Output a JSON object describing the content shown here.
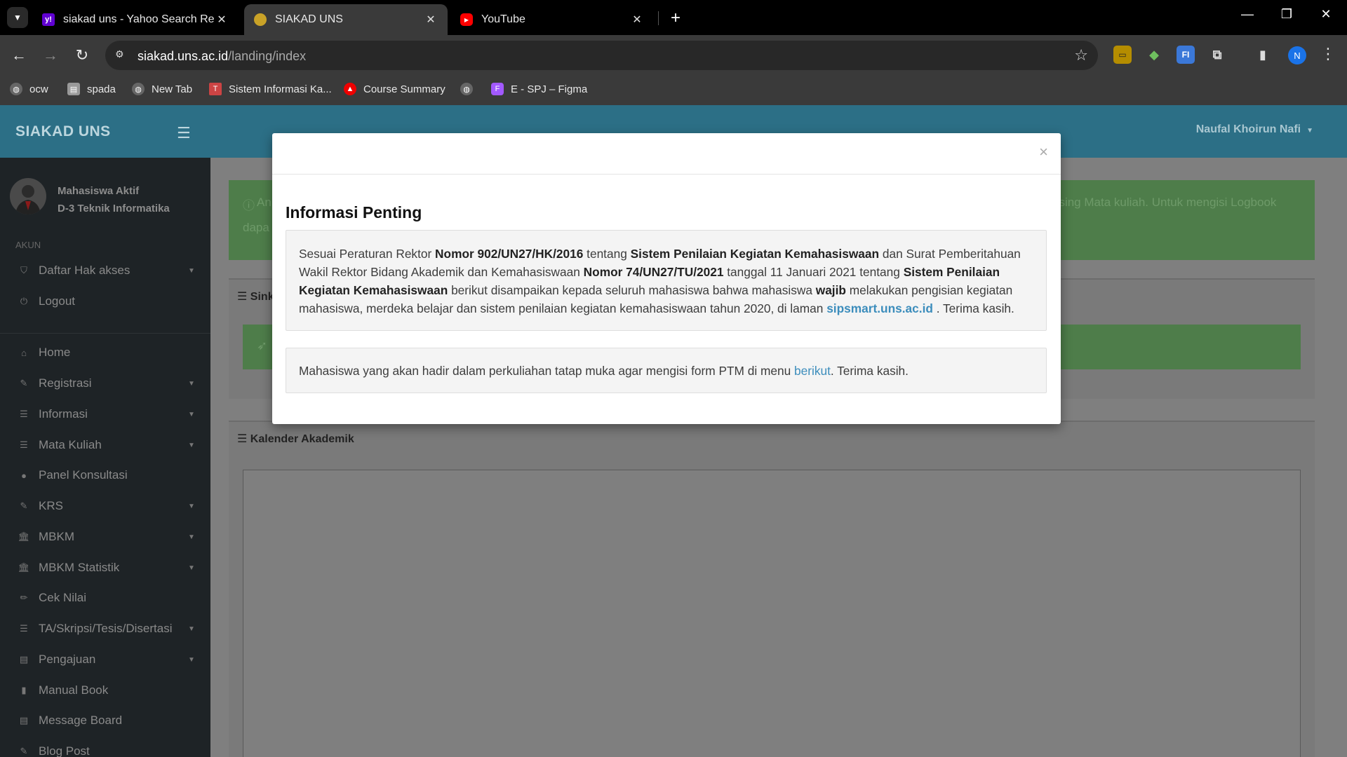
{
  "browser": {
    "tabs": [
      {
        "title": "siakad uns - Yahoo Search Resu",
        "icon": "yahoo-icon",
        "color": "#6001d2"
      },
      {
        "title": "SIAKAD UNS",
        "icon": "uns-logo-icon",
        "color": "#d4a017"
      },
      {
        "title": "YouTube",
        "icon": "youtube-icon",
        "color": "#ff0000"
      }
    ],
    "url_host": "siakad.uns.ac.id",
    "url_path": "/landing/index",
    "profile_initial": "N",
    "bookmarks": [
      {
        "label": "ocw",
        "icon": "globe-icon"
      },
      {
        "label": "spada",
        "icon": "spada-icon"
      },
      {
        "label": "New Tab",
        "icon": "globe-icon"
      },
      {
        "label": "Sistem Informasi Ka...",
        "icon": "bookmark-site-icon"
      },
      {
        "label": "Course Summary",
        "icon": "redhat-icon"
      },
      {
        "label": "",
        "icon": "globe-icon"
      },
      {
        "label": "E - SPJ – Figma",
        "icon": "figma-icon"
      }
    ]
  },
  "app": {
    "brand": "SIAKAD UNS",
    "user_name": "Naufal Khoirun Nafi",
    "status_line1": "Mahasiswa Aktif",
    "status_line2": "D-3 Teknik Informatika",
    "section_label": "AKUN",
    "account_items": [
      {
        "label": "Daftar Hak akses",
        "icon": "shield-icon",
        "caret": true
      },
      {
        "label": "Logout",
        "icon": "power-icon",
        "caret": false
      }
    ],
    "menu_items": [
      {
        "label": "Home",
        "icon": "home-icon",
        "caret": false
      },
      {
        "label": "Registrasi",
        "icon": "edit-icon",
        "caret": true
      },
      {
        "label": "Informasi",
        "icon": "list-icon",
        "caret": true
      },
      {
        "label": "Mata Kuliah",
        "icon": "list-icon",
        "caret": true
      },
      {
        "label": "Panel Konsultasi",
        "icon": "comment-icon",
        "caret": false
      },
      {
        "label": "KRS",
        "icon": "edit-icon",
        "caret": true
      },
      {
        "label": "MBKM",
        "icon": "bank-icon",
        "caret": true
      },
      {
        "label": "MBKM Statistik",
        "icon": "bank-icon",
        "caret": true
      },
      {
        "label": "Cek Nilai",
        "icon": "pencil-icon",
        "caret": false
      },
      {
        "label": "TA/Skripsi/Tesis/Disertasi",
        "icon": "list-icon",
        "caret": true
      },
      {
        "label": "Pengajuan",
        "icon": "card-icon",
        "caret": true
      },
      {
        "label": "Manual Book",
        "icon": "book-icon",
        "caret": false
      },
      {
        "label": "Message Board",
        "icon": "card-icon",
        "caret": false
      },
      {
        "label": "Blog Post",
        "icon": "edit-icon",
        "caret": false
      }
    ],
    "alert_fragment_left": "An",
    "alert_fragment_left2": "dapa",
    "alert_fragment_right": "asing Mata kuliah. Untuk mengisi Logbook",
    "box1_title_fragment": "Sink",
    "box2_title": "Kalender Akademik"
  },
  "modal": {
    "close": "×",
    "title": "Informasi Penting",
    "p1": [
      {
        "t": "Sesuai Peraturan Rektor ",
        "b": false
      },
      {
        "t": "Nomor 902/UN27/HK/2016",
        "b": true
      },
      {
        "t": " tentang ",
        "b": false
      },
      {
        "t": "Sistem Penilaian Kegiatan Kemahasiswaan",
        "b": true
      },
      {
        "t": " dan Surat Pemberitahuan Wakil Rektor Bidang Akademik dan Kemahasiswaan ",
        "b": false
      },
      {
        "t": "Nomor 74/UN27/TU/2021",
        "b": true
      },
      {
        "t": " tanggal 11 Januari 2021 tentang ",
        "b": false
      },
      {
        "t": "Sistem Penilaian Kegiatan Kemahasiswaan",
        "b": true
      },
      {
        "t": " berikut disampaikan kepada seluruh mahasiswa bahwa mahasiswa ",
        "b": false
      },
      {
        "t": "wajib",
        "b": true
      },
      {
        "t": " melakukan pengisian kegiatan mahasiswa, merdeka belajar dan sistem penilaian kegiatan kemahasiswaan tahun 2020, di laman ",
        "b": false
      }
    ],
    "p1_link": "sipsmart.uns.ac.id",
    "p1_end": " . Terima kasih.",
    "p2_before": "Mahasiswa yang akan hadir dalam perkuliahan tatap muka agar mengisi form PTM di menu ",
    "p2_link": "berikut",
    "p2_after": ". Terima kasih."
  }
}
